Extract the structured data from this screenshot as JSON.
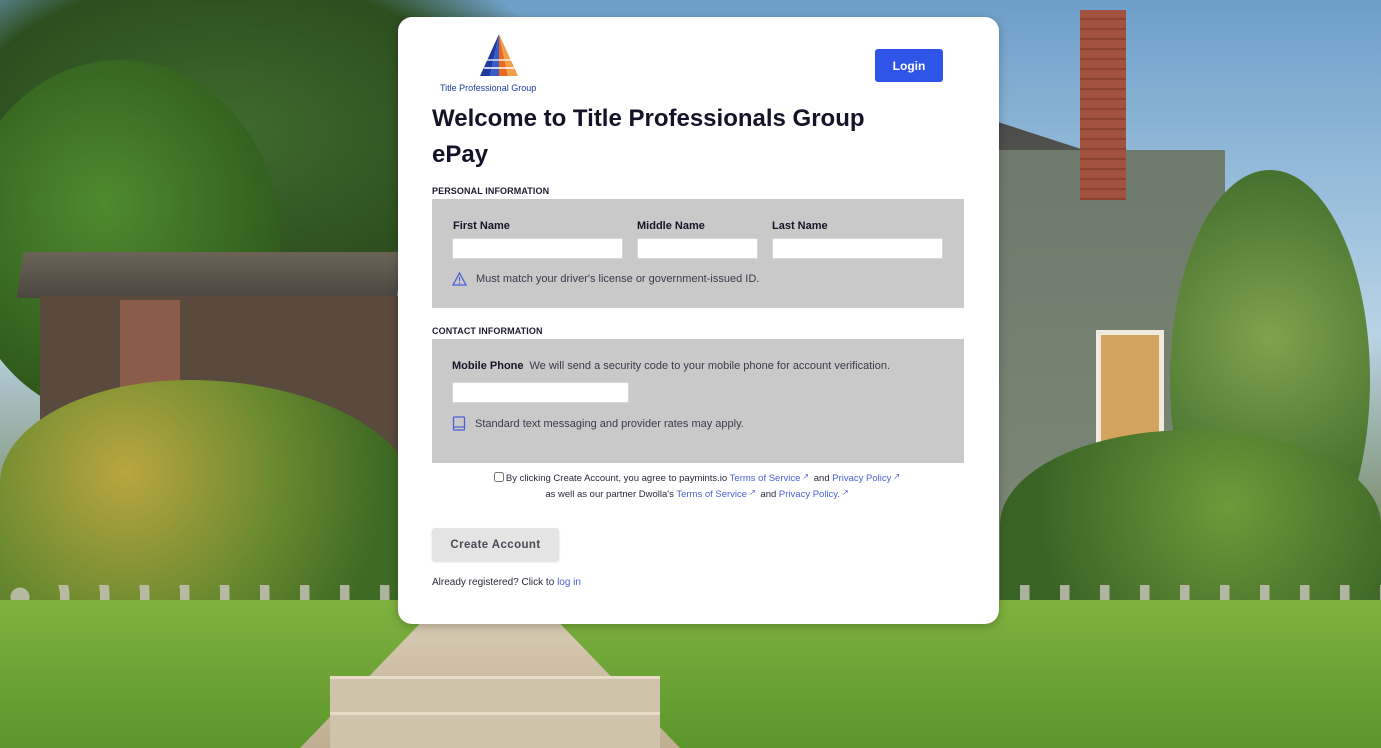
{
  "header": {
    "logo_text": "Title Professional Group",
    "login_label": "Login"
  },
  "page": {
    "title": "Welcome to Title Professionals Group ePay"
  },
  "personal": {
    "section_label": "PERSONAL INFORMATION",
    "first_name_label": "First Name",
    "middle_name_label": "Middle Name",
    "last_name_label": "Last Name",
    "first_name_value": "",
    "middle_name_value": "",
    "last_name_value": "",
    "id_note": "Must match your driver's license or government-issued ID."
  },
  "contact": {
    "section_label": "CONTACT INFORMATION",
    "mobile_label": "Mobile Phone",
    "mobile_desc": "We will send a security code to your mobile phone for account verification.",
    "mobile_value": "",
    "rates_note": "Standard text messaging and provider rates may apply."
  },
  "agreement": {
    "text_1": "By clicking Create Account, you agree to paymints.io",
    "tos_1": "Terms of Service",
    "and_1": "and",
    "privacy_1": "Privacy Policy",
    "text_2": "as well as our partner Dwolla's",
    "tos_2": "Terms of Service",
    "and_2": "and",
    "privacy_2": "Privacy Policy."
  },
  "actions": {
    "create_account_label": "Create Account",
    "already_text": "Already registered? Click to",
    "login_link": "log in"
  },
  "colors": {
    "primary": "#2f55e8",
    "link": "#4b5fd6",
    "panel_bg": "#c9c9c9",
    "logo_accent": "#e86a1f"
  },
  "icons": {
    "warning": "warning-icon",
    "phone": "phone-icon",
    "external": "external-link-icon"
  }
}
